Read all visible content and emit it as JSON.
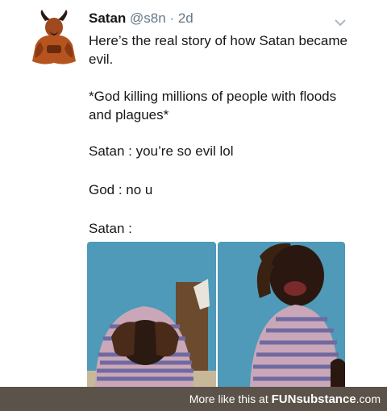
{
  "tweet": {
    "user": {
      "name": "Satan",
      "handle": "@s8n",
      "separator": "·",
      "time": "2d"
    },
    "lines": [
      "Here’s the real story of how Satan became evil.",
      "*God killing millions of people with floods and plagues*",
      "Satan : you’re so evil lol",
      "God : no u",
      "Satan :"
    ],
    "icons": {
      "avatar": "devil-avatar-icon",
      "menu": "chevron-down-icon"
    }
  },
  "footer": {
    "prefix": "More like this at",
    "brand": "FUNsubstance",
    "suffix": ".com"
  },
  "colors": {
    "text": "#14171a",
    "muted": "#657786",
    "footer_bg": "#5b5249",
    "photo_bg": "#4e9ab8"
  }
}
